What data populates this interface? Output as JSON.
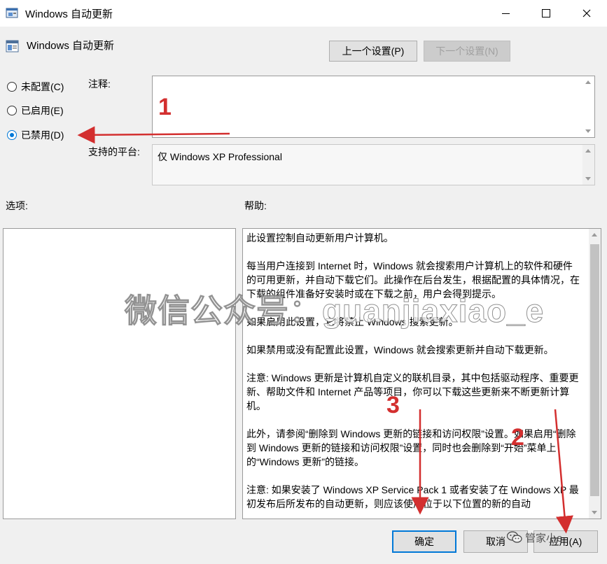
{
  "window": {
    "title": "Windows 自动更新",
    "minimize_glyph": "—",
    "maximize_glyph": "☐",
    "close_glyph": "✕"
  },
  "header": {
    "policy_title": "Windows 自动更新",
    "prev_setting": "上一个设置(P)",
    "next_setting": "下一个设置(N)"
  },
  "state": {
    "options": [
      {
        "label": "未配置(C)",
        "selected": false
      },
      {
        "label": "已启用(E)",
        "selected": false
      },
      {
        "label": "已禁用(D)",
        "selected": true
      }
    ]
  },
  "fields": {
    "comment_label": "注释:",
    "comment_value": "",
    "platform_label": "支持的平台:",
    "platform_value": "仅 Windows XP Professional"
  },
  "sections": {
    "options_label": "选项:",
    "help_label": "帮助:"
  },
  "help": {
    "paragraphs": [
      "此设置控制自动更新用户计算机。",
      "每当用户连接到 Internet 时，Windows 就会搜索用户计算机上的软件和硬件的可用更新，并自动下载它们。此操作在后台发生，根据配置的具体情况，在下载的组件准备好安装时或在下载之前，用户会得到提示。",
      "如果启用此设置，它将禁止 Windows 搜索更新。",
      "如果禁用或没有配置此设置，Windows 就会搜索更新并自动下载更新。",
      "注意: Windows 更新是计算机自定义的联机目录，其中包括驱动程序、重要更新、帮助文件和 Internet 产品等项目，你可以下载这些更新来不断更新计算机。",
      "此外，请参阅“删除到 Windows 更新的链接和访问权限”设置。如果启用“删除到 Windows 更新的链接和访问权限”设置，同时也会删除到“开始”菜单上的“Windows 更新”的链接。",
      "注意: 如果安装了 Windows XP Service Pack 1 或者安装了在 Windows XP 最初发布后所发布的自动更新，则应该使用位于以下位置的新的自动"
    ]
  },
  "buttons": {
    "ok": "确定",
    "cancel": "取消",
    "apply": "应用(A)"
  },
  "annotations": {
    "marker_1": "1",
    "marker_2": "2",
    "marker_3": "3",
    "arrow_color": "#d32f2f"
  },
  "watermark": {
    "text": "微信公众号：guanjiaxiao_e",
    "corner_text": "管家小e"
  }
}
